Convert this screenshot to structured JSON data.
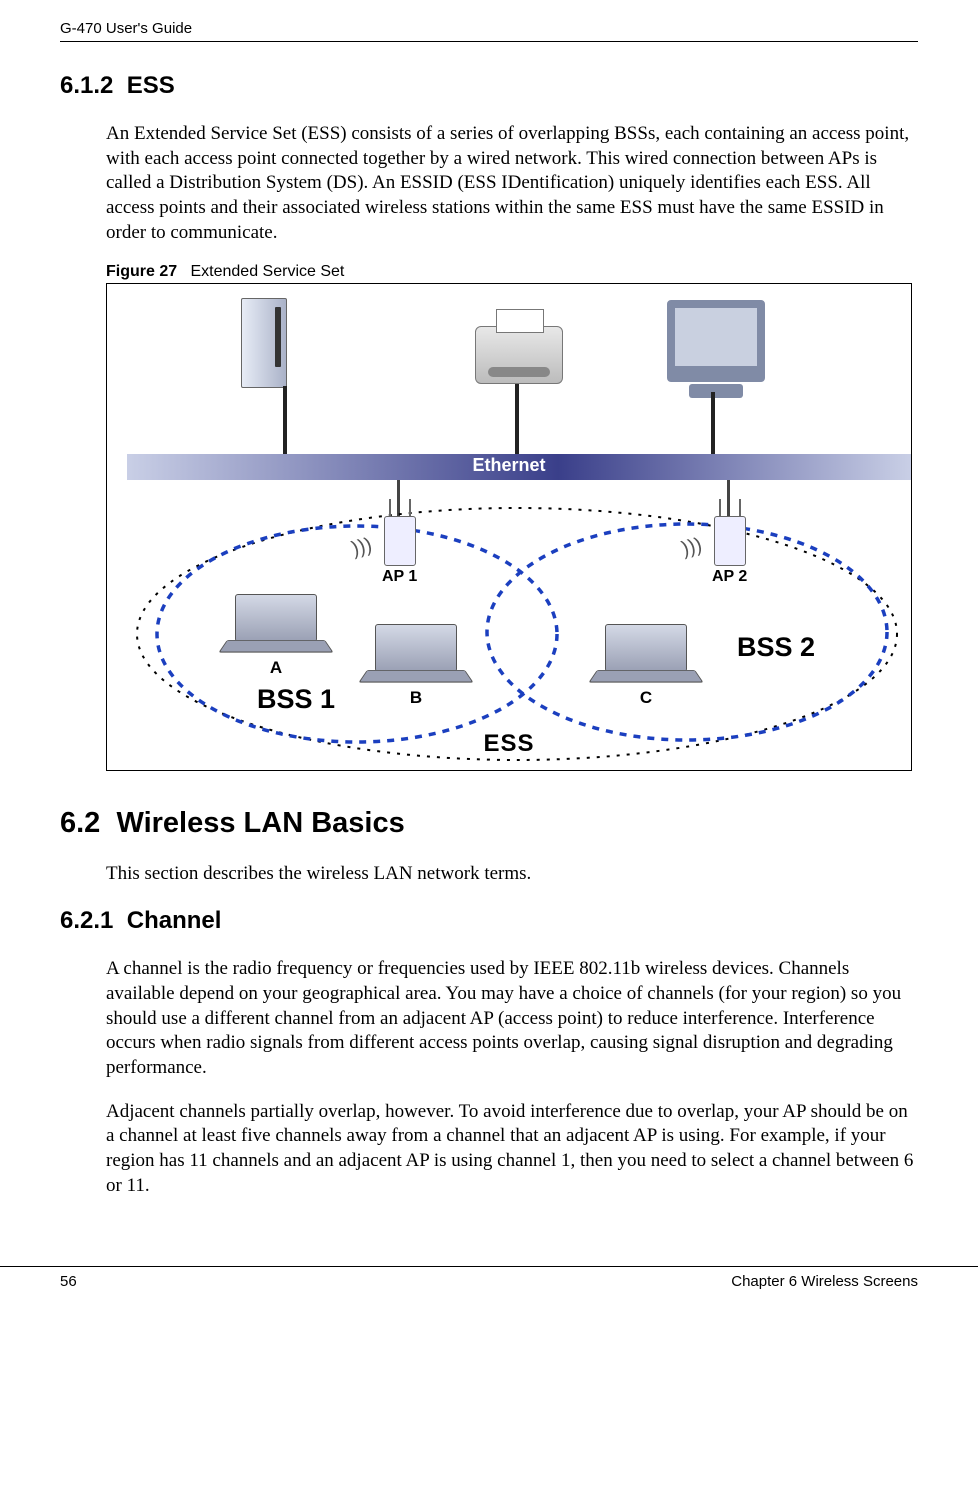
{
  "header": {
    "title": "G-470 User's Guide"
  },
  "sections": {
    "s612": {
      "num": "6.1.2",
      "title": "ESS",
      "para1": "An Extended Service Set (ESS) consists of a series of overlapping BSSs, each containing an access point, with each access point connected together by a wired network. This wired connection between APs is called a Distribution System (DS). An ESSID (ESS IDentification) uniquely identifies each ESS. All access points and their associated wireless stations within the same ESS must have the same ESSID in order to communicate."
    },
    "fig27": {
      "label": "Figure 27",
      "caption": "Extended Service Set",
      "ethernet": "Ethernet",
      "ap1": "AP 1",
      "ap2": "AP 2",
      "bss1": "BSS 1",
      "bss2": "BSS 2",
      "ess": "ESS",
      "lapA": "A",
      "lapB": "B",
      "lapC": "C"
    },
    "s62": {
      "num": "6.2",
      "title": "Wireless LAN Basics",
      "para1": "This section describes the wireless LAN network terms."
    },
    "s621": {
      "num": "6.2.1",
      "title": "Channel",
      "para1": "A channel is the radio frequency or frequencies used by IEEE 802.11b wireless devices. Channels available depend on your geographical area. You may have a choice of channels (for your region) so you should use a different channel from an adjacent AP (access point) to reduce interference. Interference occurs when radio signals from different access points overlap, causing signal disruption and degrading performance.",
      "para2": "Adjacent channels partially overlap, however. To avoid interference due to overlap, your AP should be on a channel at least five channels away from a channel that an adjacent AP is using. For example, if your region has 11 channels and an adjacent AP is using channel 1, then you need to select a channel between 6 or 11."
    }
  },
  "footer": {
    "page": "56",
    "chapter": "Chapter 6 Wireless Screens"
  }
}
